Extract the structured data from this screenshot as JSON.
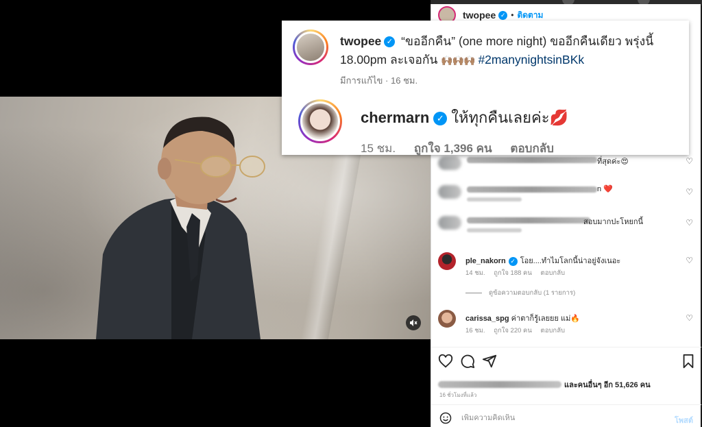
{
  "post": {
    "username": "twopee",
    "follow_label": "ติดตาม",
    "dot": "•"
  },
  "callout": {
    "caption": {
      "username": "twopee",
      "text_1": "“ขออีกคืน” (one more night) ขออีกคืนเดียว พรุ่งนี้ 18.00pm ละเจอกัน",
      "emoji": "🙌🏽🙌🏽🙌🏽",
      "hashtag": "#2manynightsinBKk",
      "edited": "มีการแก้ไข",
      "sep": "·",
      "time": "16 ชม."
    },
    "reply": {
      "username": "chermarn",
      "text": "ให้ทุกคืนเลยค่ะ",
      "emoji": "💋",
      "time": "15 ชม.",
      "likes": "ถูกใจ 1,396 คน",
      "reply_label": "ตอบกลับ"
    }
  },
  "comments": {
    "partial_1": {
      "tail": "ที่สุดค่ะ😍"
    },
    "partial_2": {
      "tail": "n ❤️"
    },
    "partial_3": {
      "tail": "สอบมากปะโหยกนี้"
    },
    "ple": {
      "username": "ple_nakorn",
      "text": "โอย....ทำไมโลกนี้น่าอยู่จังเนอะ",
      "time": "14 ชม.",
      "likes": "ถูกใจ 188 คน",
      "reply_label": "ตอบกลับ",
      "view_replies": "ดูข้อความตอบกลับ (1 รายการ)"
    },
    "carissa": {
      "username": "carissa_spg",
      "text": "ค่าตาก็รู้เลยยย แม่🔥",
      "time": "16 ชม.",
      "likes": "ถูกใจ 220 คน",
      "reply_label": "ตอบกลับ"
    }
  },
  "likes_summary": {
    "text": "และคนอื่นๆ อีก 51,626 คน",
    "time_ago": "16 ชั่วโมงที่แล้ว"
  },
  "add_comment": {
    "placeholder": "เพิ่มความคิดเห็น",
    "post_label": "โพสต์"
  },
  "icons": {
    "heart": "heart-icon",
    "comment": "comment-icon",
    "share": "share-icon",
    "save": "bookmark-icon",
    "mute": "muted-speaker-icon",
    "emoji": "emoji-icon"
  },
  "colors": {
    "accent": "#0095f6",
    "hashtag": "#00376b",
    "muted_text": "#8e8e8e"
  }
}
